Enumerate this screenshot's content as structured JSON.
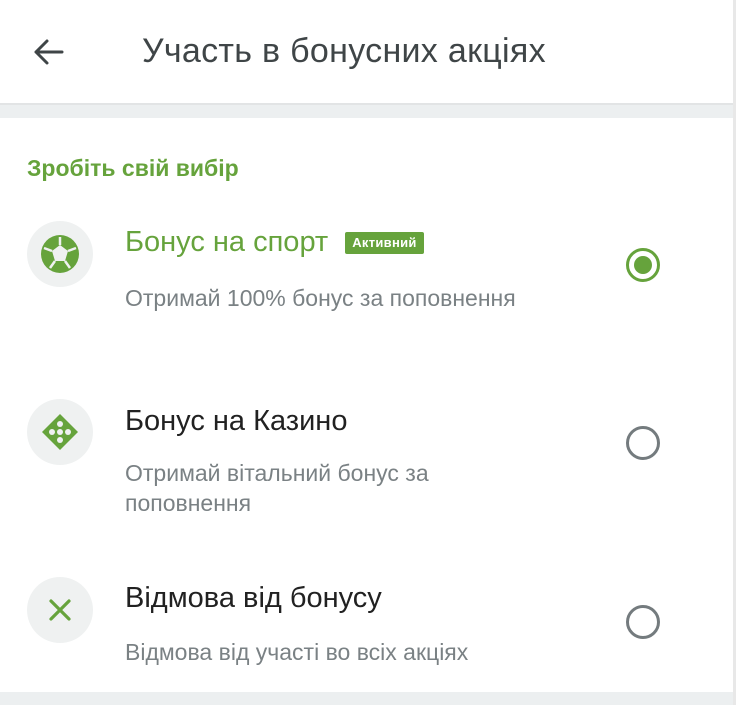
{
  "header": {
    "title": "Участь в бонусних акціях"
  },
  "section": {
    "title": "Зробіть свій вибір"
  },
  "options": [
    {
      "icon": "soccer-ball-icon",
      "title": "Бонус на спорт",
      "badge": "Активний",
      "description": "Отримай 100% бонус за поповнення",
      "selected": true
    },
    {
      "icon": "casino-dice-icon",
      "title": "Бонус на Казино",
      "description": "Отримай вітальний бонус за поповнення",
      "selected": false
    },
    {
      "icon": "close-icon",
      "title": "Відмова від бонусу",
      "description": "Відмова від участі во всіх акціях",
      "selected": false
    }
  ],
  "colors": {
    "accent": "#66a33c",
    "title_text": "#3f4547",
    "secondary_text": "#7a8184",
    "radio_unselected": "#747b7e"
  }
}
